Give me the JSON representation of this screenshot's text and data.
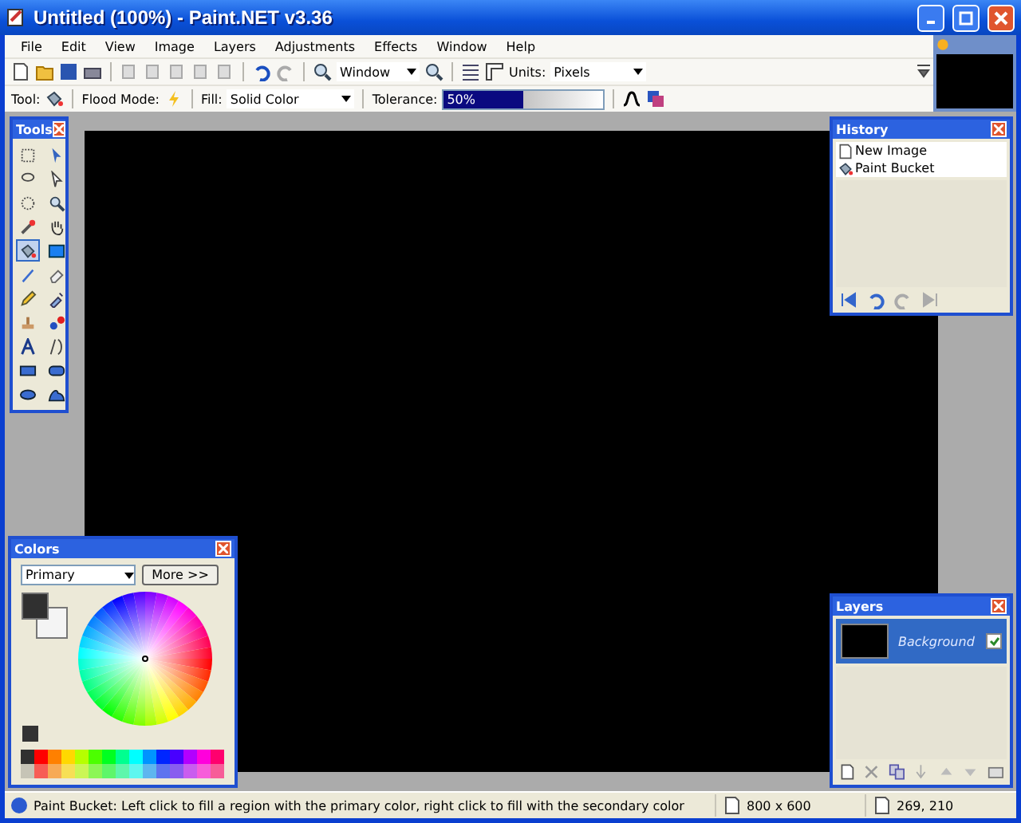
{
  "window": {
    "title": "Untitled (100%) - Paint.NET v3.36"
  },
  "menu": [
    "File",
    "Edit",
    "View",
    "Image",
    "Layers",
    "Adjustments",
    "Effects",
    "Window",
    "Help"
  ],
  "toolbar": {
    "zoom": "Window",
    "units_label": "Units:",
    "units": "Pixels"
  },
  "tool_bar": {
    "tool_label": "Tool:",
    "flood_label": "Flood Mode:",
    "fill_label": "Fill:",
    "fill": "Solid Color",
    "tolerance_label": "Tolerance:",
    "tolerance": "50%",
    "level": 0.5
  },
  "tools_panel": {
    "title": "Tools",
    "tools": [
      {
        "selected": false
      },
      {
        "selected": false
      },
      {
        "selected": false
      },
      {
        "selected": false
      },
      {
        "selected": false
      },
      {
        "selected": false
      },
      {
        "selected": false
      },
      {
        "selected": false
      },
      {
        "selected": true
      },
      {
        "selected": false
      },
      {
        "selected": false
      },
      {
        "selected": false
      },
      {
        "selected": false
      },
      {
        "selected": false
      },
      {
        "selected": false
      },
      {
        "selected": false
      },
      {
        "selected": false
      },
      {
        "selected": false
      },
      {
        "selected": false
      },
      {
        "selected": false
      },
      {
        "selected": false
      },
      {
        "selected": false
      }
    ]
  },
  "history_panel": {
    "title": "History",
    "items": [
      {
        "label": "New Image"
      },
      {
        "label": "Paint Bucket"
      }
    ]
  },
  "colors_panel": {
    "title": "Colors",
    "mode": "Primary",
    "more": "More >>"
  },
  "layers_panel": {
    "title": "Layers",
    "layers": [
      {
        "name": "Background",
        "selected": true,
        "visible": true
      }
    ]
  },
  "status_bar": {
    "hint": "Paint Bucket: Left click to fill a region with the primary color, right click to fill with the secondary color",
    "size": "800 x 600",
    "position": "269, 210"
  }
}
